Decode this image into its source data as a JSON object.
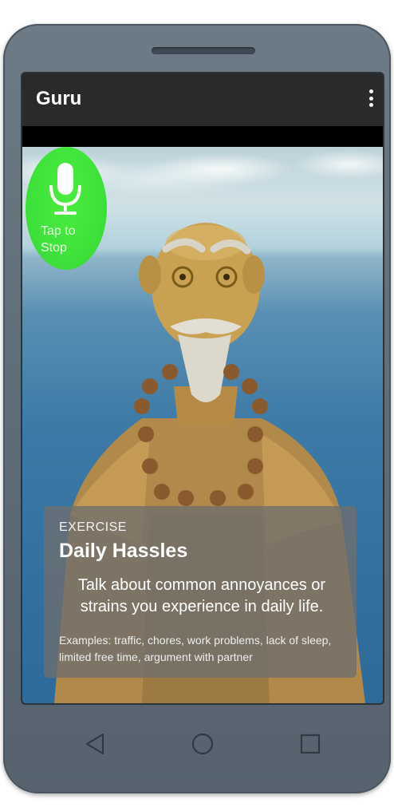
{
  "app": {
    "title": "Guru"
  },
  "toolbar": {
    "overflow_icon": "more-vert-icon"
  },
  "mic": {
    "icon": "microphone-icon",
    "label_line1": "Tap to",
    "label_line2": "Stop",
    "color": "#3ee23a"
  },
  "exercise": {
    "tag": "EXERCISE",
    "title": "Daily Hassles",
    "prompt": "Talk about common annoyances or strains you experience in daily life.",
    "examples": "Examples: traffic, chores, work problems, lack of sleep, limited free time, argument with partner"
  },
  "navigation": {
    "back_icon": "back-triangle-icon",
    "home_icon": "home-circle-icon",
    "recents_icon": "recents-square-icon"
  },
  "colors": {
    "app_bar": "#2a2a2a",
    "phone_body": "#5f6d79",
    "card_overlay": "#6e6e6e"
  }
}
